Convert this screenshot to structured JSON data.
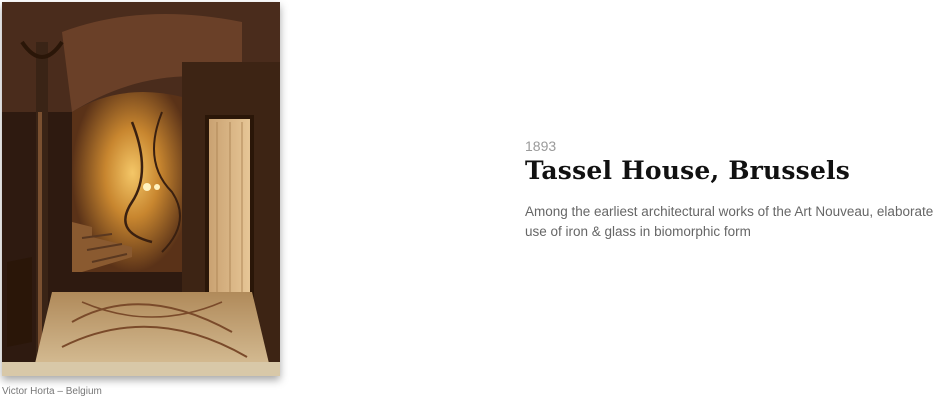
{
  "artwork": {
    "year": "1893",
    "title": "Tassel House, Brussels",
    "description": "Among the earliest architectural works of the Art Nouveau, elaborate use of iron & glass in biomorphic form"
  },
  "photo": {
    "caption": "Victor Horta – Belgium"
  }
}
